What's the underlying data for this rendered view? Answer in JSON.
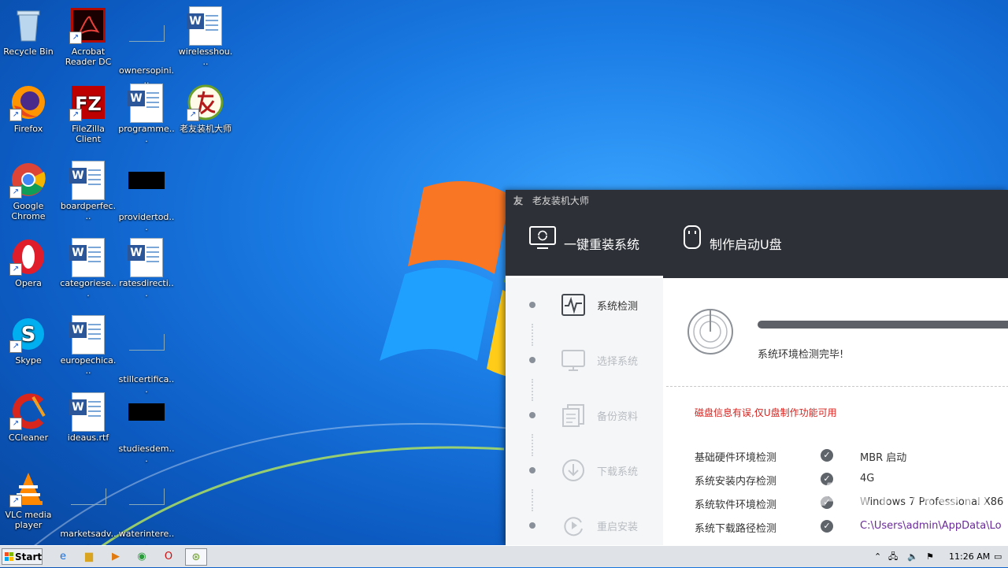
{
  "desktop": {
    "icons": [
      {
        "label": "Recycle Bin",
        "icon": "recycle-bin-icon"
      },
      {
        "label": "Acrobat Reader DC",
        "icon": "acrobat-icon"
      },
      {
        "label": "ownersopini...",
        "icon": "blank-file-icon"
      },
      {
        "label": "wirelesshou...",
        "icon": "word-doc-icon"
      },
      {
        "label": "Firefox",
        "icon": "firefox-icon"
      },
      {
        "label": "FileZilla Client",
        "icon": "filezilla-icon"
      },
      {
        "label": "programme...",
        "icon": "word-doc-icon"
      },
      {
        "label": "老友装机大师",
        "icon": "laoyou-icon"
      },
      {
        "label": "Google Chrome",
        "icon": "chrome-icon"
      },
      {
        "label": "boardperfec...",
        "icon": "word-doc-icon"
      },
      {
        "label": "providertod...",
        "icon": "black-file-icon"
      },
      {
        "label": "Opera",
        "icon": "opera-icon"
      },
      {
        "label": "categoriese...",
        "icon": "word-doc-icon"
      },
      {
        "label": "ratesdirecti...",
        "icon": "word-doc-icon"
      },
      {
        "label": "Skype",
        "icon": "skype-icon"
      },
      {
        "label": "europechica...",
        "icon": "word-doc-icon"
      },
      {
        "label": "stillcertifica...",
        "icon": "blank-file-icon"
      },
      {
        "label": "CCleaner",
        "icon": "ccleaner-icon"
      },
      {
        "label": "ideaus.rtf",
        "icon": "word-doc-icon"
      },
      {
        "label": "studiesdem...",
        "icon": "black-file-icon"
      },
      {
        "label": "VLC media player",
        "icon": "vlc-icon"
      },
      {
        "label": "marketsadv...",
        "icon": "blank-file-icon"
      },
      {
        "label": "waterintere...",
        "icon": "blank-file-icon"
      }
    ]
  },
  "app": {
    "title": "老友装机大师",
    "tabs": [
      {
        "label": "一键重装系统"
      },
      {
        "label": "制作启动U盘"
      }
    ],
    "steps": [
      {
        "label": "系统检测"
      },
      {
        "label": "选择系统"
      },
      {
        "label": "备份资料"
      },
      {
        "label": "下载系统"
      },
      {
        "label": "重启安装"
      }
    ],
    "status_text": "系统环境检测完毕!",
    "warning": "磁盘信息有误,仅U盘制作功能可用",
    "checks": [
      {
        "label": "基础硬件环境检测",
        "value": "MBR 启动"
      },
      {
        "label": "系统安装内存检测",
        "value": "4G"
      },
      {
        "label": "系统软件环境检测",
        "value": "Windows 7 Professional X86"
      },
      {
        "label": "系统下载路径检测",
        "value": "C:\\Users\\admin\\AppData\\Lo"
      }
    ]
  },
  "watermark": "ANY RUN",
  "taskbar": {
    "start_label": "Start",
    "clock": "11:26 AM"
  }
}
